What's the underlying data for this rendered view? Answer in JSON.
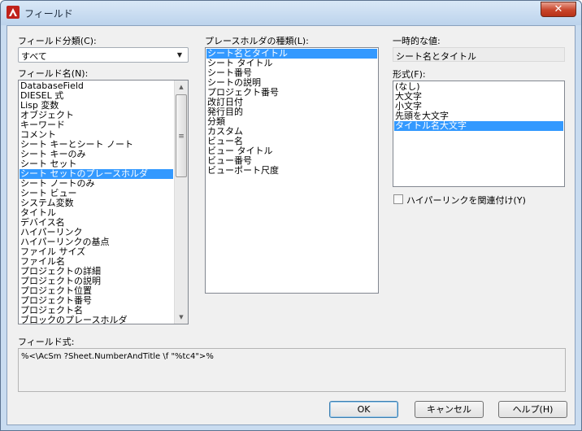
{
  "window": {
    "title": "フィールド",
    "close_glyph": "✕",
    "close_icon": "close-icon",
    "app_icon": "autocad-icon"
  },
  "category": {
    "label": "フィールド分類(C):",
    "selected": "すべて"
  },
  "field_names": {
    "label": "フィールド名(N):",
    "items": [
      "DatabaseField",
      "DIESEL 式",
      "Lisp 変数",
      "オブジェクト",
      "キーワード",
      "コメント",
      "シート キーとシート ノート",
      "シート キーのみ",
      "シート セット",
      "シート セットのプレースホルダ",
      "シート ノートのみ",
      "シート ビュー",
      "システム変数",
      "タイトル",
      "デバイス名",
      "ハイパーリンク",
      "ハイパーリンクの基点",
      "ファイル サイズ",
      "ファイル名",
      "プロジェクトの詳細",
      "プロジェクトの説明",
      "プロジェクト位置",
      "プロジェクト番号",
      "プロジェクト名",
      "ブロックのプレースホルダ"
    ],
    "selected_index": 9
  },
  "placeholder_types": {
    "label": "プレースホルダの種類(L):",
    "items": [
      "シート名とタイトル",
      "シート タイトル",
      "シート番号",
      "シートの説明",
      "プロジェクト番号",
      "改訂日付",
      "発行目的",
      "分類",
      "カスタム",
      "ビュー名",
      "ビュー タイトル",
      "ビュー番号",
      "ビューポート尺度"
    ],
    "selected_index": 0
  },
  "temp_value": {
    "label": "一時的な値:",
    "value": "シート名とタイトル"
  },
  "format": {
    "label": "形式(F):",
    "items": [
      "(なし)",
      "大文字",
      "小文字",
      "先頭を大文字",
      "タイトル名大文字"
    ],
    "selected_index": 4
  },
  "hyperlink_checkbox": {
    "label": "ハイパーリンクを関連付け(Y)",
    "checked": false
  },
  "expression": {
    "label": "フィールド式:",
    "value": "%<\\AcSm ?Sheet.NumberAndTitle \\f \"%tc4\">%"
  },
  "buttons": {
    "ok": "OK",
    "cancel": "キャンセル",
    "help": "ヘルプ(H)"
  },
  "colors": {
    "selection": "#3399ff",
    "title_bar": "#c9dcf0",
    "dialog_bg": "#f0f0f0"
  }
}
